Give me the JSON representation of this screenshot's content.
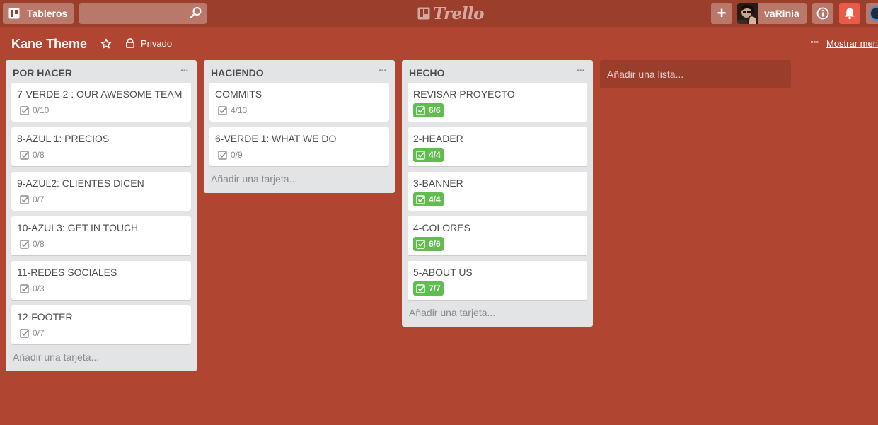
{
  "header": {
    "boards_label": "Tableros",
    "search_value": "",
    "logo_text": "Trello",
    "add_label": "+",
    "user_name": "vaRinia",
    "bell_color": "#eb5a46"
  },
  "board": {
    "title": "Kane Theme",
    "privacy": "Privado",
    "menu_dots": "···",
    "menu_label": "Mostrar menú",
    "background": "#b04632"
  },
  "lists": [
    {
      "title": "POR HACER",
      "menu": "···",
      "add_card": "Añadir una tarjeta...",
      "cards": [
        {
          "title": "7-VERDE 2 : OUR AWESOME TEAM",
          "checklist": "0/10",
          "complete": false
        },
        {
          "title": "8-AZUL 1: PRECIOS",
          "checklist": "0/8",
          "complete": false
        },
        {
          "title": "9-AZUL2: CLIENTES DICEN",
          "checklist": "0/7",
          "complete": false
        },
        {
          "title": "10-AZUL3: GET IN TOUCH",
          "checklist": "0/8",
          "complete": false
        },
        {
          "title": "11-REDES SOCIALES",
          "checklist": "0/3",
          "complete": false
        },
        {
          "title": "12-FOOTER",
          "checklist": "0/7",
          "complete": false
        }
      ]
    },
    {
      "title": "HACIENDO",
      "menu": "···",
      "add_card": "Añadir una tarjeta...",
      "cards": [
        {
          "title": "COMMITS",
          "checklist": "4/13",
          "complete": false
        },
        {
          "title": "6-VERDE 1: WHAT WE DO",
          "checklist": "0/9",
          "complete": false
        }
      ]
    },
    {
      "title": "HECHO",
      "menu": "···",
      "add_card": "Añadir una tarjeta...",
      "cards": [
        {
          "title": "REVISAR PROYECTO",
          "checklist": "6/6",
          "complete": true
        },
        {
          "title": "2-HEADER",
          "checklist": "4/4",
          "complete": true
        },
        {
          "title": "3-BANNER",
          "checklist": "4/4",
          "complete": true
        },
        {
          "title": "4-COLORES",
          "checklist": "6/6",
          "complete": true
        },
        {
          "title": "5-ABOUT US",
          "checklist": "7/7",
          "complete": true
        }
      ]
    }
  ],
  "add_list_label": "Añadir una lista...",
  "colors": {
    "complete_badge": "#61bd4f",
    "list_bg": "#e2e4e6",
    "header_bg": "#9c3e2c"
  }
}
